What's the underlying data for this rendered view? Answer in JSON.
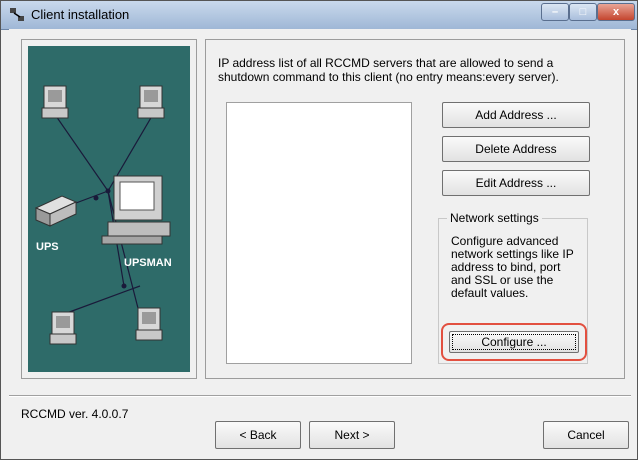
{
  "window": {
    "title": "Client installation",
    "minimize_glyph": "–",
    "maximize_glyph": "□",
    "close_glyph": "x"
  },
  "illustration": {
    "ups_label": "UPS",
    "upsman_label": "UPSMAN",
    "background_color": "#2e6b69"
  },
  "main": {
    "description": "IP address list of all RCCMD servers that are allowed to send a shutdown command to this client (no entry means:every server).",
    "address_list": [],
    "add_button": "Add Address ...",
    "delete_button": "Delete Address",
    "edit_button": "Edit Address ...",
    "network_settings": {
      "legend": "Network settings",
      "text": "Configure advanced network settings like IP address to bind, port and SSL or use the default values.",
      "configure_button": "Configure ...",
      "highlight_color": "#e25040"
    }
  },
  "footer": {
    "version": "RCCMD ver. 4.0.0.7",
    "back_button": "< Back",
    "next_button": "Next >",
    "cancel_button": "Cancel"
  }
}
